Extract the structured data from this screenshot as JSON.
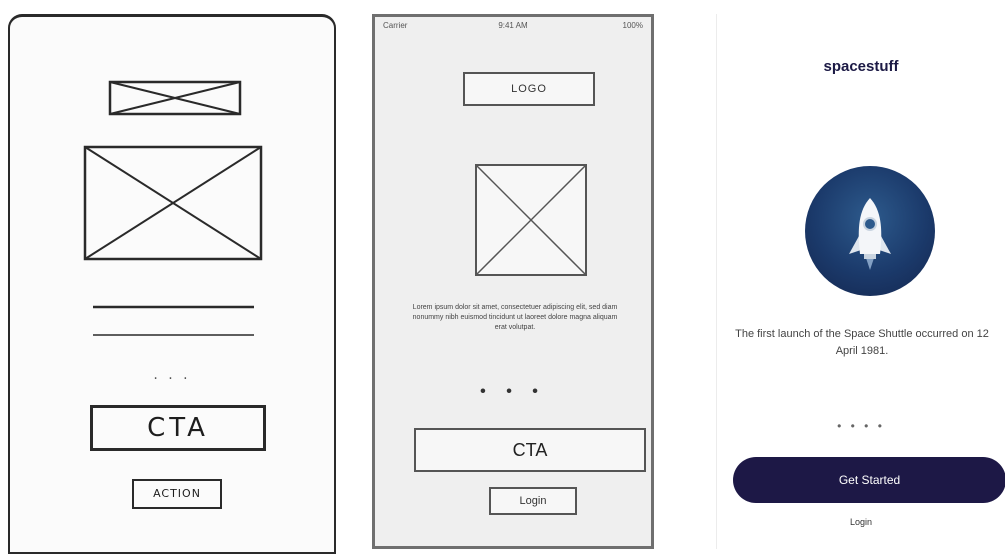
{
  "sketch": {
    "cta_label": "CTA",
    "action_label": "ACTION",
    "dots": ". . ."
  },
  "wireframe": {
    "status_bar": {
      "carrier": "Carrier",
      "time": "9:41 AM",
      "battery": "100%"
    },
    "logo_label": "LOGO",
    "body_text": "Lorem ipsum dolor sit amet, consectetuer adipiscing elit, sed diam nonummy nibh euismod tincidunt ut laoreet dolore magna aliquam erat volutpat.",
    "dots": "• • •",
    "cta_label": "CTA",
    "login_label": "Login"
  },
  "final": {
    "brand": "spacestuff",
    "fact_text": "The first launch of the Space Shuttle occurred on 12 April 1981.",
    "dots": "• • • •",
    "get_started_label": "Get Started",
    "login_label": "Login",
    "colors": {
      "primary": "#1d1846",
      "circle": "#1b3a6b"
    }
  }
}
